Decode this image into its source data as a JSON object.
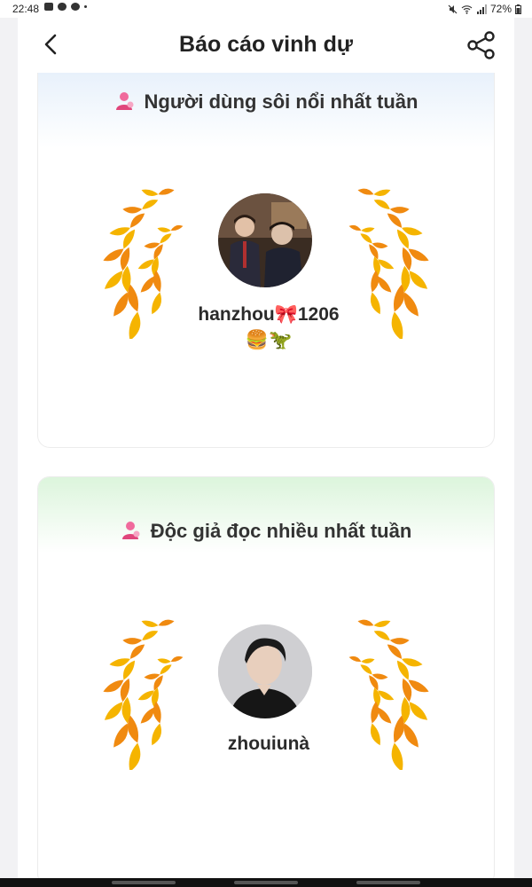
{
  "status_bar": {
    "time": "22:48",
    "battery": "72%",
    "left_icons": [
      "image-icon",
      "cloud-icon",
      "app-icon",
      "dot-icon"
    ],
    "right_icons": [
      "mute-icon",
      "wifi-icon",
      "signal-icon",
      "battery-icon"
    ]
  },
  "header": {
    "title": "Báo cáo vinh dự",
    "back_icon": "chevron-left-icon",
    "share_icon": "share-icon"
  },
  "sections": [
    {
      "title": "Người dùng sôi nổi nhất tuần",
      "user": {
        "name": "hanzhou🎀1206🍔🦖"
      }
    },
    {
      "title": "Độc giả đọc nhiều nhất tuần",
      "user": {
        "name": "zhouiunà"
      }
    }
  ],
  "colors": {
    "accent_pink": "#e0457b",
    "wreath_gold": "#f5b400",
    "wreath_orange": "#f08a10",
    "card1_header": "#e8f1fb",
    "card2_header": "#dcf5dc"
  }
}
